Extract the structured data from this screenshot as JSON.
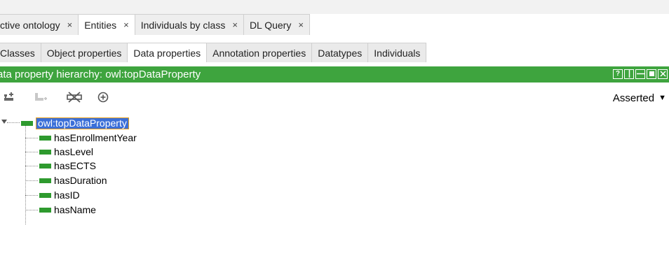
{
  "tabs": [
    {
      "label": "ctive ontology",
      "close": "×"
    },
    {
      "label": "Entities",
      "close": "×",
      "active": true
    },
    {
      "label": "Individuals by class",
      "close": "×"
    },
    {
      "label": "DL Query",
      "close": "×"
    }
  ],
  "subtabs": [
    {
      "label": "Classes"
    },
    {
      "label": "Object properties"
    },
    {
      "label": "Data properties",
      "active": true
    },
    {
      "label": "Annotation properties"
    },
    {
      "label": "Datatypes"
    },
    {
      "label": "Individuals"
    }
  ],
  "hierarchy": {
    "title": "ata property hierarchy: owl:topDataProperty",
    "color": "#3ea43e"
  },
  "toolbar": {
    "mode_label": "Asserted",
    "icons": [
      "add-sub-property-icon",
      "add-sibling-property-icon",
      "delete-property-icon",
      "find-usage-icon"
    ]
  },
  "tree": {
    "root": "owl:topDataProperty",
    "children": [
      "hasEnrollmentYear",
      "hasLevel",
      "hasECTS",
      "hasDuration",
      "hasID",
      "hasName"
    ]
  },
  "colors": {
    "green": "#3ea43e",
    "selection": "#3b6fd8",
    "selection_border": "#e6a01f"
  }
}
